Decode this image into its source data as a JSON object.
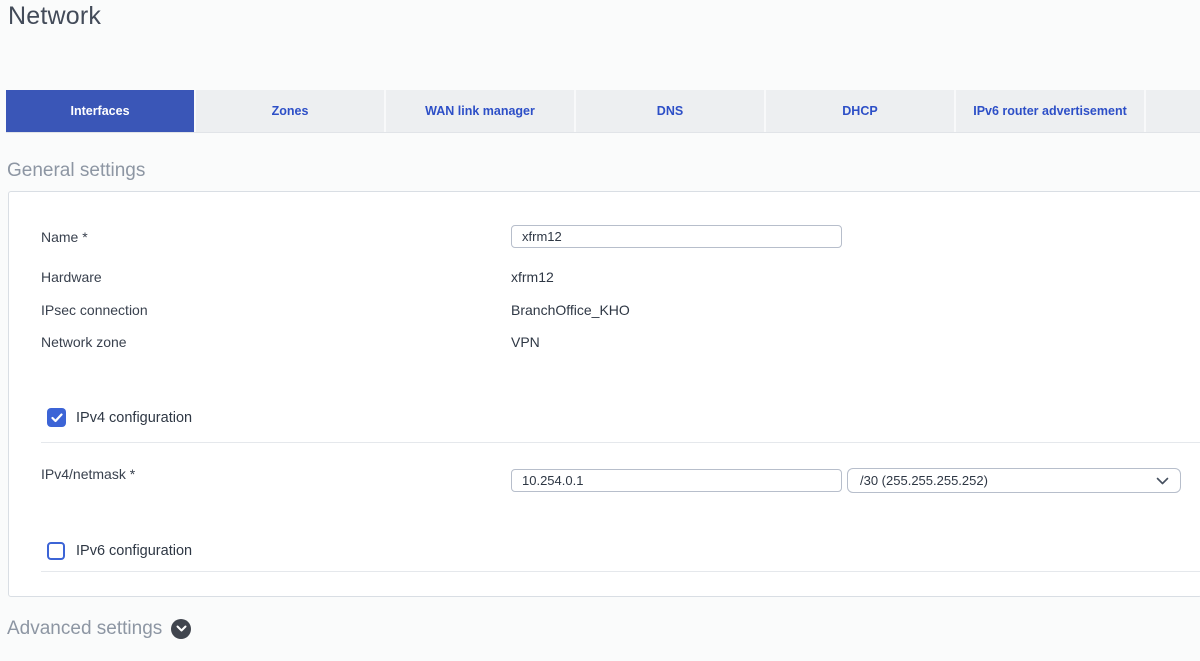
{
  "page": {
    "title": "Network"
  },
  "tabs": {
    "items": [
      {
        "label": "Interfaces",
        "active": true
      },
      {
        "label": "Zones",
        "active": false
      },
      {
        "label": "WAN link manager",
        "active": false
      },
      {
        "label": "DNS",
        "active": false
      },
      {
        "label": "DHCP",
        "active": false
      },
      {
        "label": "IPv6 router advertisement",
        "active": false
      }
    ]
  },
  "general_settings": {
    "heading": "General settings",
    "name": {
      "label": "Name *",
      "value": "xfrm12"
    },
    "hardware": {
      "label": "Hardware",
      "value": "xfrm12"
    },
    "ipsec_connection": {
      "label": "IPsec connection",
      "value": "BranchOffice_KHO"
    },
    "network_zone": {
      "label": "Network zone",
      "value": "VPN"
    },
    "ipv4_configuration": {
      "label": "IPv4 configuration",
      "checked": "true"
    },
    "ipv4_netmask": {
      "label": "IPv4/netmask *",
      "ip": "10.254.0.1",
      "netmask_selected": "/30 (255.255.255.252)"
    },
    "ipv6_configuration": {
      "label": "IPv6 configuration",
      "checked": "false"
    }
  },
  "advanced_settings": {
    "heading": "Advanced settings"
  },
  "icons": {
    "checkbox_check": "check-icon",
    "select_chevron": "chevron-down-icon",
    "advanced_toggle": "chevron-down-circle-icon"
  },
  "colors": {
    "active_tab_bg": "#3a56b7",
    "tab_text": "#2d4fc7",
    "checkbox_blue": "#3c64d6",
    "section_header_text": "#8d96a3",
    "panel_border": "#d9dee4",
    "page_background": "#fafbfb"
  }
}
